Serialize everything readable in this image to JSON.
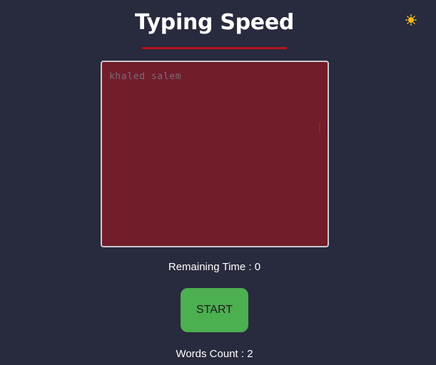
{
  "app": {
    "title": "Typing Speed",
    "theme_icon": "sun-icon"
  },
  "typing_area": {
    "text": "khaled salem"
  },
  "timer": {
    "label": "Remaining Time : 0",
    "value": 0
  },
  "controls": {
    "start_label": "START"
  },
  "stats": {
    "words_label": "Words Count : 2",
    "words_count": 2
  },
  "colors": {
    "background": "#282a3d",
    "accent_underline": "#b3141d",
    "text_area_bg": "#711d2a",
    "start_button": "#4caf50",
    "sun_icon": "#f5b81e"
  }
}
